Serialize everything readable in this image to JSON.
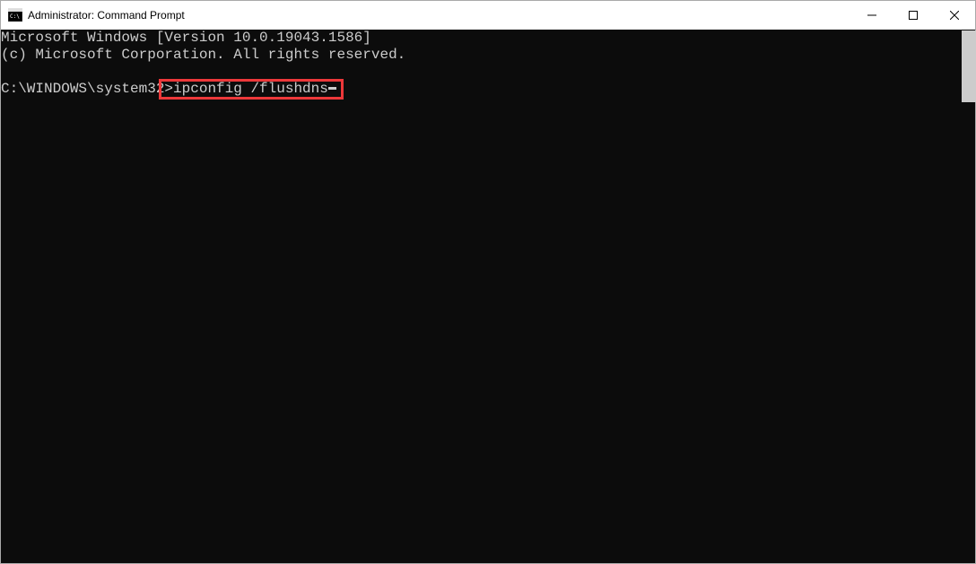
{
  "window": {
    "title": "Administrator: Command Prompt"
  },
  "terminal": {
    "banner_line1": "Microsoft Windows [Version 10.0.19043.1586]",
    "banner_line2": "(c) Microsoft Corporation. All rights reserved.",
    "prompt_path": "C:\\WINDOWS\\system32>",
    "command": "ipconfig /flushdns"
  }
}
